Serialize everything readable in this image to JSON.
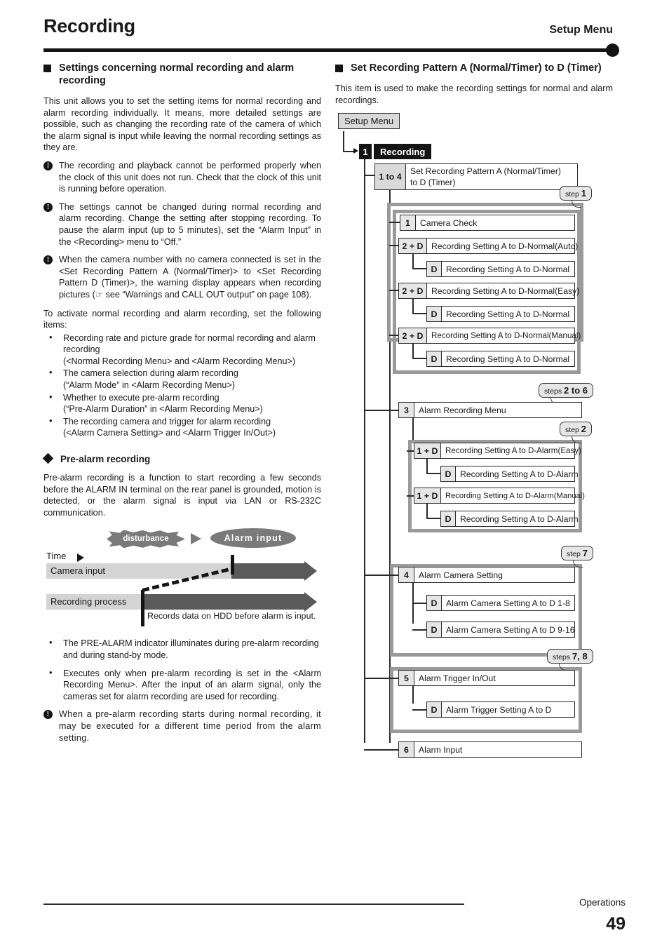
{
  "header": {
    "title": "Recording",
    "subtitle": "Setup Menu"
  },
  "footer": {
    "label": "Operations",
    "page_number": "49"
  },
  "left_column": {
    "section_heading": "Settings concerning normal recording and alarm recording",
    "intro": "This unit allows you to set the setting items for normal recording and alarm recording individually. It means, more detailed settings are possible, such as changing the recording rate of the camera of which the alarm signal is input while leaving the normal recording settings as they are.",
    "notes": [
      "The recording and playback cannot be performed properly when the clock of this unit does not run. Check that the clock of this unit is running before operation.",
      "The settings cannot be changed during normal recording and alarm recording. Change the setting after stopping recording. To pause the alarm input (up to 5 minutes), set the “Alarm Input” in the <Recording> menu to “Off.”",
      "When the camera number with no camera connected is set in the <Set Recording Pattern A (Normal/Timer)> to <Set Recording Pattern D (Timer)>, the warning display appears when recording pictures (☞ see “Warnings and CALL OUT output” on page 108)."
    ],
    "activate_intro": "To activate normal recording and alarm recording, set the following items:",
    "activate_items": [
      {
        "main": "Recording rate and picture grade for normal recording and alarm recording",
        "sub": "(<Normal Recording Menu> and <Alarm Recording Menu>)"
      },
      {
        "main": "The camera selection during alarm recording",
        "sub": "(“Alarm Mode” in <Alarm Recording Menu>)"
      },
      {
        "main": "Whether to execute pre-alarm recording",
        "sub": "(“Pre-Alarm Duration” in <Alarm Recording Menu>)"
      },
      {
        "main": "The recording camera and trigger for alarm recording",
        "sub": "(<Alarm Camera Setting> and <Alarm Trigger In/Out>)"
      }
    ],
    "prealarm_heading": "Pre-alarm recording",
    "prealarm_intro": "Pre-alarm recording is a function to start recording a few seconds before the ALARM IN terminal on the rear panel is grounded, motion is detected, or the alarm signal is input via LAN or RS-232C communication.",
    "figure": {
      "disturbance_label": "disturbance",
      "alarm_input_label": "Alarm input",
      "time_label": "Time",
      "camera_input_label": "Camera input",
      "recording_process_label": "Recording process",
      "caption": "Records data on HDD before alarm is input."
    },
    "prealarm_items": [
      "The PRE-ALARM indicator illuminates during pre-alarm recording and during stand-by mode.",
      "Executes only when pre-alarm recording is set in the <Alarm Recording Menu>. After the input of an alarm signal, only the cameras set for alarm recording are used for recording."
    ],
    "prealarm_note": "When a pre-alarm recording starts during normal recording, it may be executed for a different time period from the alarm setting."
  },
  "right_column": {
    "section_heading": "Set Recording Pattern A (Normal/Timer) to D (Timer)",
    "intro": "This item is used to make the recording settings for normal and alarm recordings.",
    "flow": {
      "root_label": "Setup Menu",
      "recording_num": "1",
      "recording_label": "Recording",
      "pattern_num": "1 to 4",
      "pattern_label_line1": "Set Recording Pattern A (Normal/Timer)",
      "pattern_label_line2": "to D (Timer)",
      "callouts": {
        "step1": {
          "prefix": "step",
          "value": "1"
        },
        "steps2to6": {
          "prefix": "steps",
          "value": "2 to 6"
        },
        "step2": {
          "prefix": "step",
          "value": "2"
        },
        "step7": {
          "prefix": "step",
          "value": "7"
        },
        "steps78": {
          "prefix": "steps",
          "value": "7, 8"
        }
      },
      "nodes": [
        {
          "num": "1",
          "label": "Camera Check"
        },
        {
          "num": "2 + D",
          "label": "Recording Setting A to D-Normal(Auto)"
        },
        {
          "num": "D",
          "label": "Recording Setting A to D-Normal"
        },
        {
          "num": "2 + D",
          "label": "Recording Setting A to D-Normal(Easy)"
        },
        {
          "num": "D",
          "label": "Recording Setting A to D-Normal"
        },
        {
          "num": "2 + D",
          "label": "Recording Setting A to D-Normal(Manual)"
        },
        {
          "num": "D",
          "label": "Recording Setting A to D-Normal"
        },
        {
          "num": "3",
          "label": "Alarm Recording Menu"
        },
        {
          "num": "1 + D",
          "label": "Recording Setting A to D-Alarm(Easy)"
        },
        {
          "num": "D",
          "label": "Recording Setting A to D-Alarm"
        },
        {
          "num": "1 + D",
          "label": "Recording Setting A to D-Alarm(Manual)"
        },
        {
          "num": "D",
          "label": "Recording Setting A to D-Alarm"
        },
        {
          "num": "4",
          "label": "Alarm Camera Setting"
        },
        {
          "num": "D",
          "label": "Alarm Camera Setting A to D 1-8"
        },
        {
          "num": "D",
          "label": "Alarm Camera Setting A to D 9-16"
        },
        {
          "num": "5",
          "label": "Alarm Trigger In/Out"
        },
        {
          "num": "D",
          "label": "Alarm Trigger Setting A to D"
        },
        {
          "num": "6",
          "label": "Alarm Input"
        }
      ]
    }
  }
}
